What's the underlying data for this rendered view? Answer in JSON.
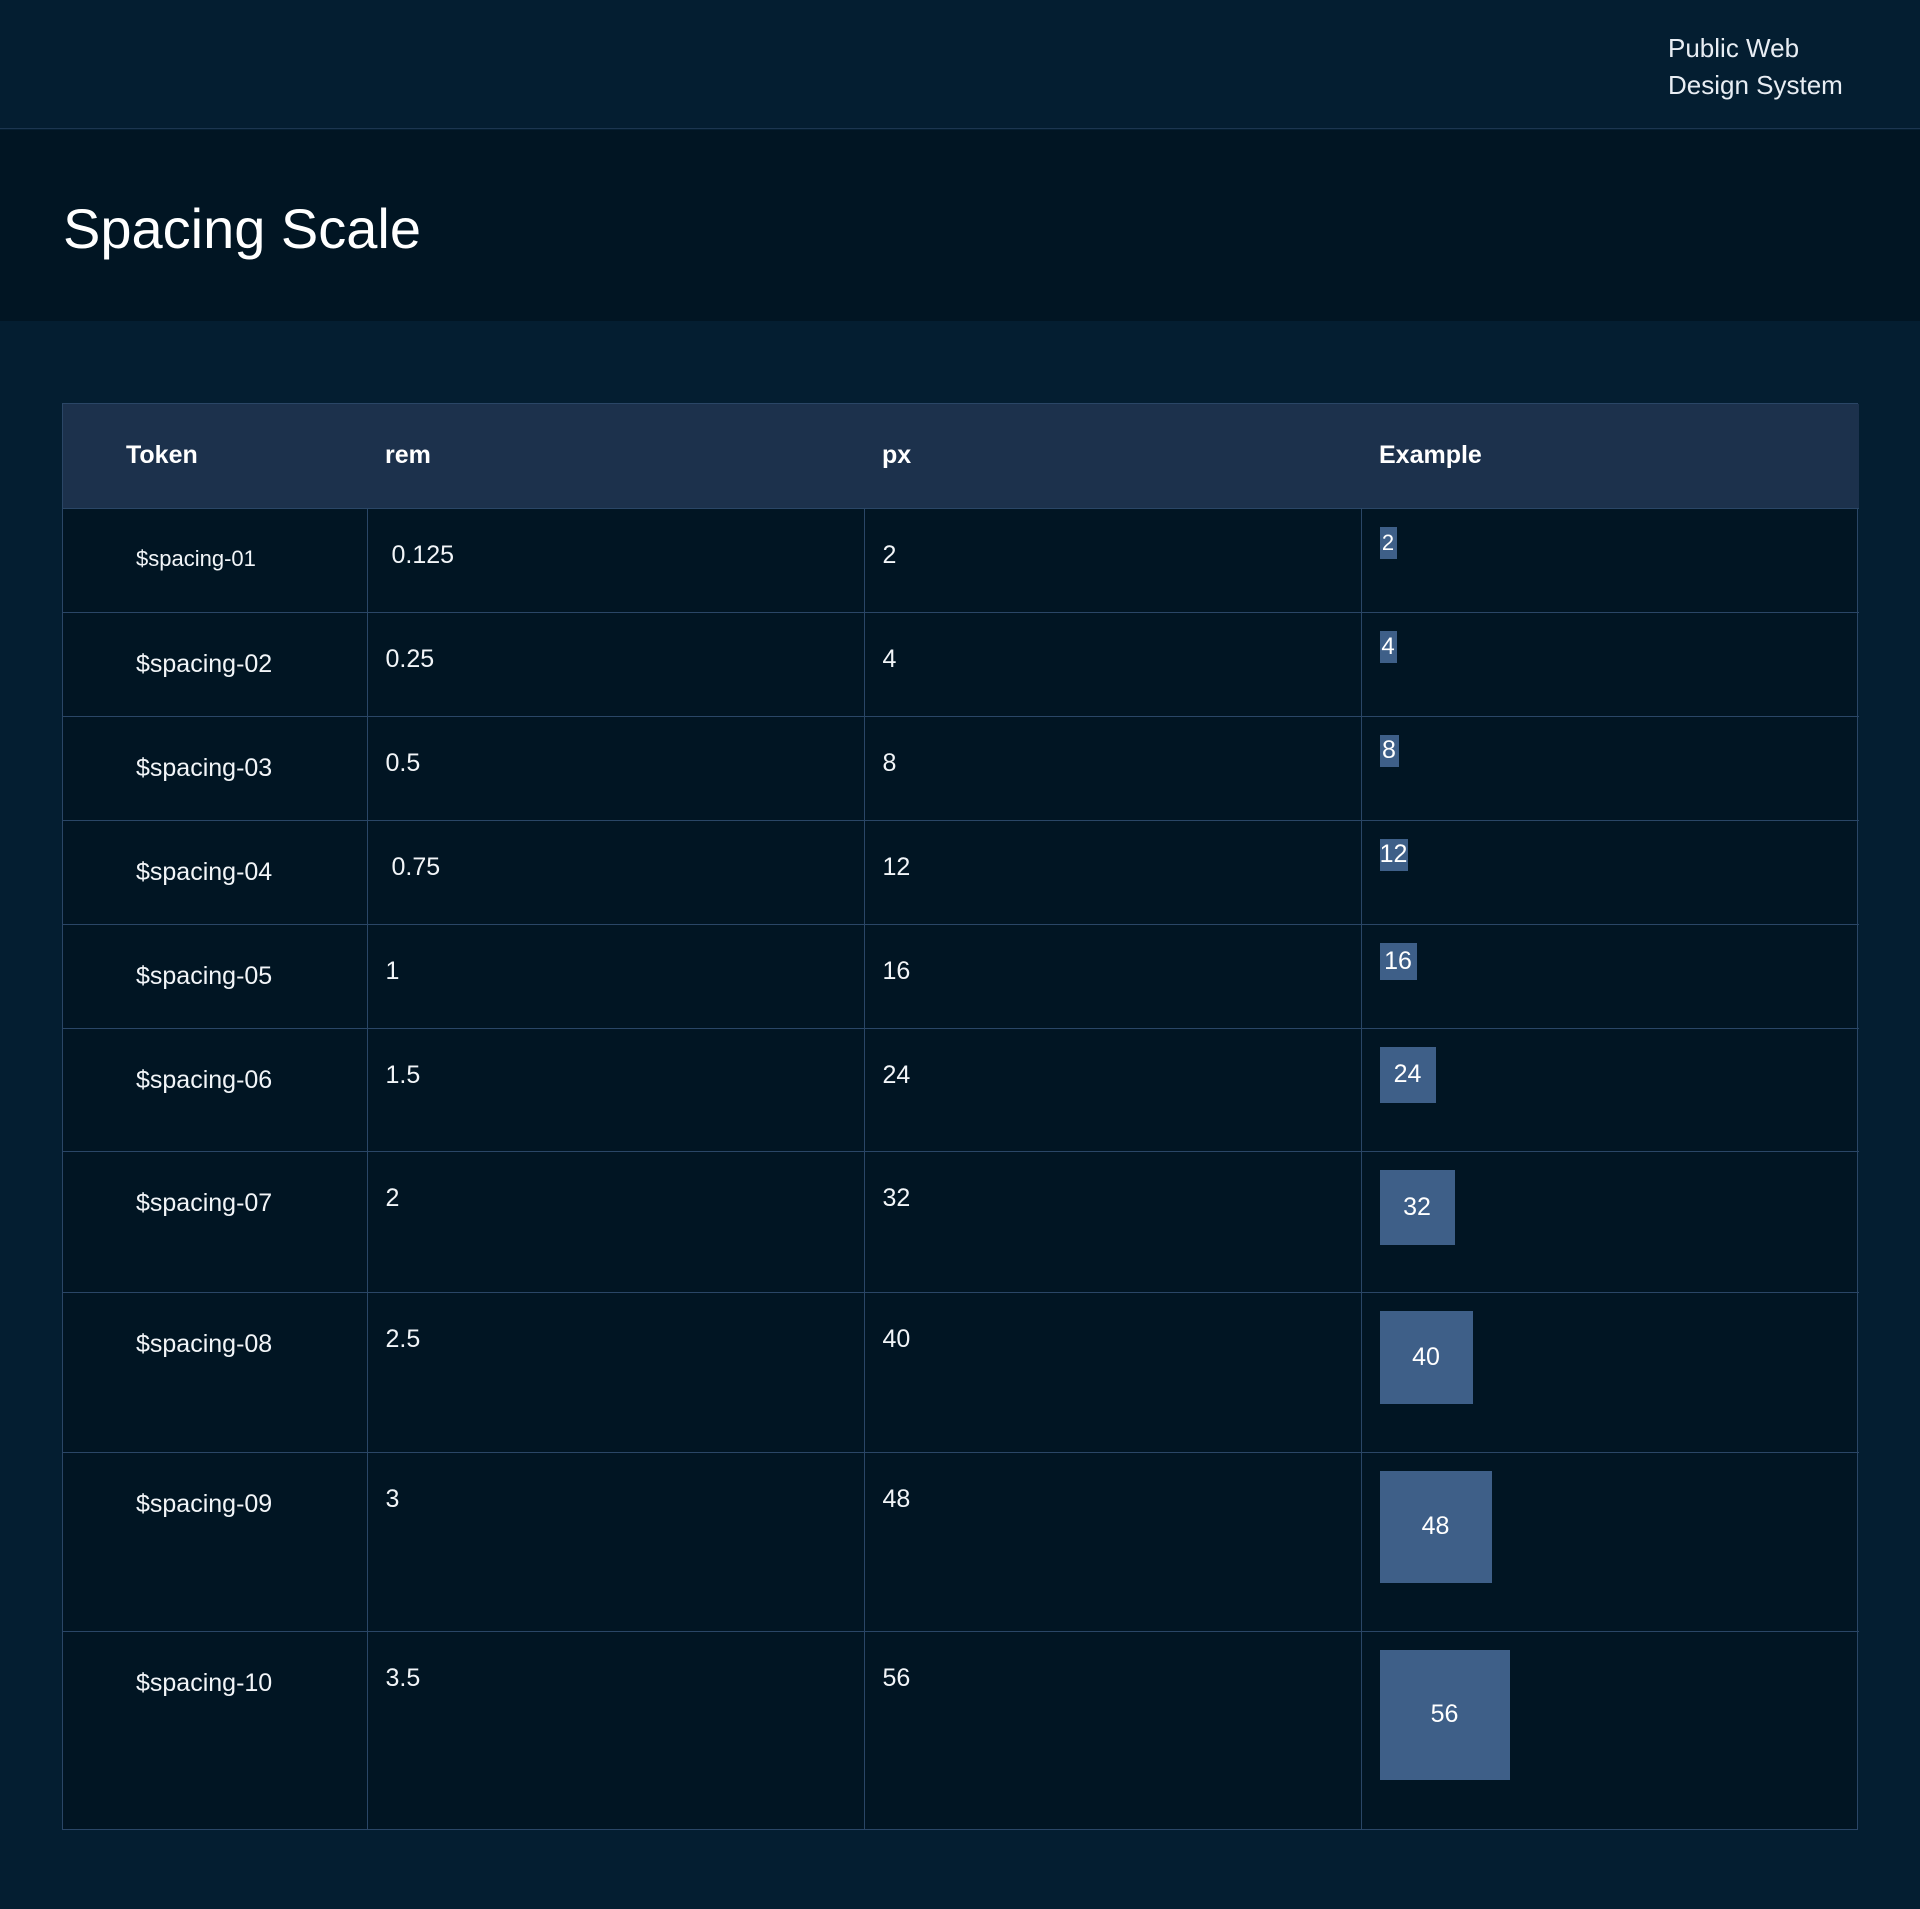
{
  "header": {
    "brand_line1": "Public Web",
    "brand_line2": "Design System"
  },
  "hero": {
    "title": "Spacing Scale"
  },
  "table": {
    "columns": [
      "Token",
      "rem",
      "px",
      "Example"
    ],
    "rows": [
      {
        "token": "$spacing-01",
        "rem": "0.125",
        "px": "2",
        "example": "2"
      },
      {
        "token": "$spacing-02",
        "rem": "0.25",
        "px": "4",
        "example": "4"
      },
      {
        "token": "$spacing-03",
        "rem": "0.5",
        "px": "8",
        "example": "8"
      },
      {
        "token": "$spacing-04",
        "rem": "0.75",
        "px": "12",
        "example": "12"
      },
      {
        "token": "$spacing-05",
        "rem": "1",
        "px": "16",
        "example": "16"
      },
      {
        "token": "$spacing-06",
        "rem": "1.5",
        "px": "24",
        "example": "24"
      },
      {
        "token": "$spacing-07",
        "rem": "2",
        "px": "32",
        "example": "32"
      },
      {
        "token": "$spacing-08",
        "rem": "2.5",
        "px": "40",
        "example": "40"
      },
      {
        "token": "$spacing-09",
        "rem": "3",
        "px": "48",
        "example": "48"
      },
      {
        "token": "$spacing-10",
        "rem": "3.5",
        "px": "56",
        "example": "56"
      }
    ]
  },
  "colors": {
    "page_background": "#041e31",
    "hero_background": "#011523",
    "table_header_background": "#1c314c",
    "swatch": "#3e5f88",
    "border": "#2a4666"
  }
}
